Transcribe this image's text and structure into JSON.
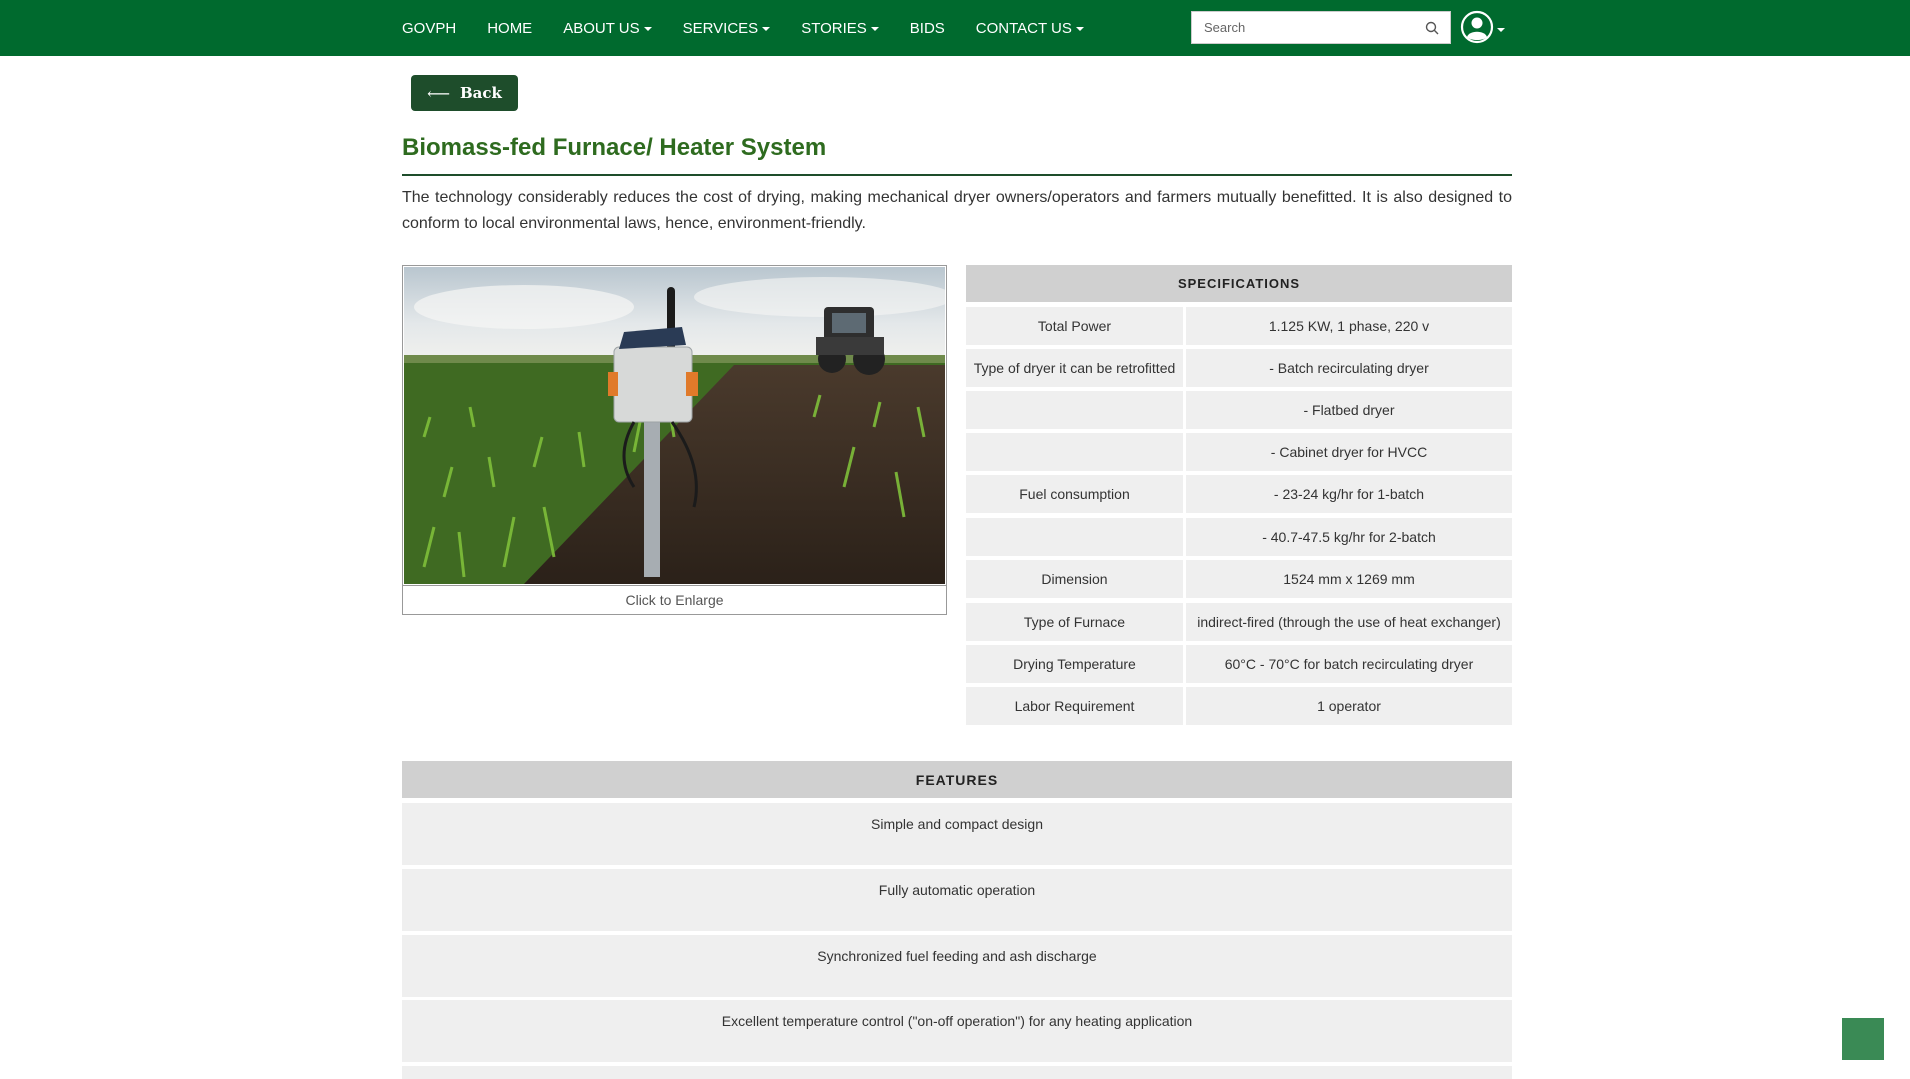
{
  "nav": {
    "items": [
      {
        "label": "GOVPH",
        "dropdown": false
      },
      {
        "label": "HOME",
        "dropdown": false
      },
      {
        "label": "ABOUT US",
        "dropdown": true
      },
      {
        "label": "SERVICES",
        "dropdown": true
      },
      {
        "label": "STORIES",
        "dropdown": true
      },
      {
        "label": "BIDS",
        "dropdown": false
      },
      {
        "label": "CONTACT US",
        "dropdown": true
      }
    ],
    "search_placeholder": "Search",
    "search_icon": "search-icon",
    "user_icon": "user-circle-icon"
  },
  "back_label": "Back",
  "page_title": "Biomass-fed Furnace/ Heater System",
  "description": "The technology considerably reduces the cost of drying, making mechanical dryer owners/operators and farmers mutually benefitted. It is also designed to conform to local environmental laws, hence, environment-friendly.",
  "image_caption": "Click to Enlarge",
  "specifications": {
    "heading": "SPECIFICATIONS",
    "rows": [
      {
        "label": "Total Power",
        "value": "1.125 KW, 1 phase, 220 v"
      },
      {
        "label": "Type of dryer it can be retrofitted",
        "value": "- Batch recirculating dryer"
      },
      {
        "label": "",
        "value": "- Flatbed dryer"
      },
      {
        "label": "",
        "value": "- Cabinet dryer for HVCC"
      },
      {
        "label": "Fuel consumption",
        "value": "- 23-24 kg/hr for 1-batch"
      },
      {
        "label": "",
        "value": "- 40.7-47.5 kg/hr for 2-batch"
      },
      {
        "label": "Dimension",
        "value": "1524 mm x 1269 mm"
      },
      {
        "label": "Type of Furnace",
        "value": "indirect-fired (through the use of heat exchanger)"
      },
      {
        "label": "Drying Temperature",
        "value": "60°C - 70°C for batch recirculating dryer"
      },
      {
        "label": "Labor Requirement",
        "value": "1 operator"
      }
    ]
  },
  "features": {
    "heading": "FEATURES",
    "items": [
      "Simple and compact design",
      "Fully automatic operation",
      "Synchronized fuel feeding and ash discharge",
      "Excellent temperature control (\"on-off operation\") for any heating application"
    ]
  },
  "colors": {
    "topbar": "#006a2e",
    "back_button": "#1e4d2b",
    "title": "#2e6b1f",
    "header_gray": "#d0d0d0",
    "cell_gray": "#efefef",
    "scroll_button": "#3a8a55"
  }
}
